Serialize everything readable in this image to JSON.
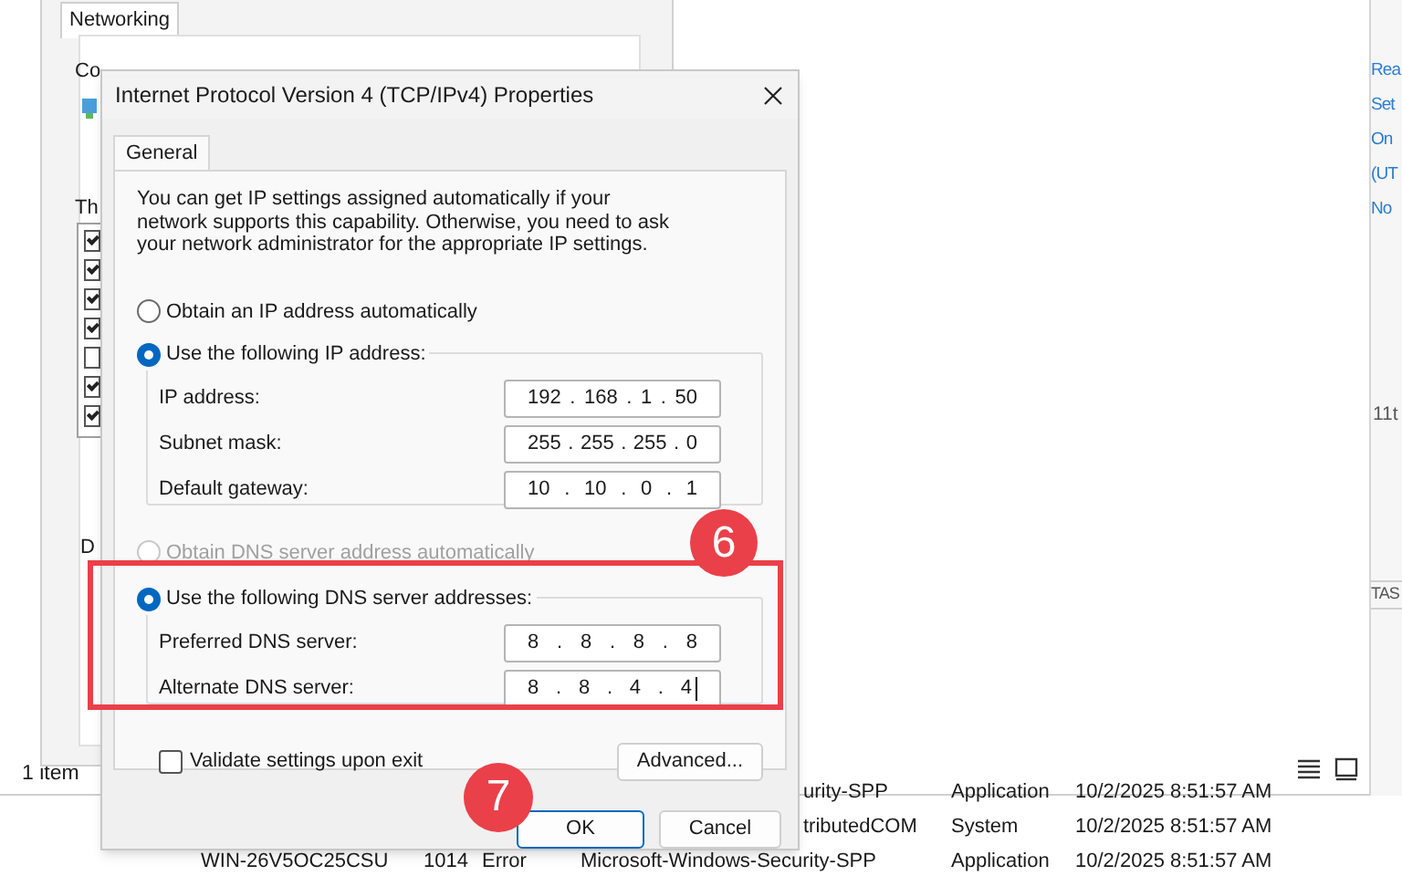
{
  "explorer": {
    "status": "1 item"
  },
  "networking_window": {
    "tab": "Networking",
    "label_1": "Co",
    "label_2": "Th",
    "label_3": "D",
    "items": [
      {
        "checked": true
      },
      {
        "checked": true
      },
      {
        "checked": true
      },
      {
        "checked": true
      },
      {
        "checked": false
      },
      {
        "checked": true
      },
      {
        "checked": true
      }
    ]
  },
  "side_panel": {
    "links": [
      "Rea",
      "Set",
      "On",
      "(UT",
      "No"
    ],
    "text_1": "11t",
    "text_2": "TAS"
  },
  "event_rows": [
    {
      "cells": [
        "urity-SPP",
        "Application",
        "10/2/2025 8:51:57 AM"
      ]
    },
    {
      "cells": [
        "tributedCOM",
        "System",
        "10/2/2025 8:51:57 AM"
      ]
    },
    {
      "cells": [
        "WIN-26V5OC25CSU",
        "1014",
        "Error",
        "Microsoft-Windows-Security-SPP",
        "Application",
        "10/2/2025 8:51:57 AM"
      ]
    }
  ],
  "dialog": {
    "title": "Internet Protocol Version 4 (TCP/IPv4) Properties",
    "tabs": [
      {
        "label": "General",
        "selected": true
      }
    ],
    "description": "You can get IP settings assigned automatically if your network supports this capability. Otherwise, you need to ask your network administrator for the appropriate IP settings.",
    "ip_auto": {
      "label": "Obtain an IP address automatically",
      "selected": false,
      "disabled": false
    },
    "ip_manual": {
      "label": "Use the following IP address:",
      "selected": true
    },
    "ip_fields": [
      {
        "label": "IP address:",
        "segments": [
          "192",
          ".",
          "168",
          ".",
          "1",
          ".",
          "50"
        ],
        "focused": false
      },
      {
        "label": "Subnet mask:",
        "segments": [
          "255",
          ".",
          "255",
          ".",
          "255",
          ".",
          "0"
        ],
        "focused": false
      },
      {
        "label": "Default gateway:",
        "segments": [
          "10",
          ".",
          "10",
          ".",
          "0",
          ".",
          "1"
        ],
        "focused": false
      }
    ],
    "dns_auto": {
      "label": "Obtain DNS server address automatically",
      "selected": false,
      "disabled": true
    },
    "dns_manual": {
      "label": "Use the following DNS server addresses:",
      "selected": true
    },
    "dns_fields": [
      {
        "label": "Preferred DNS server:",
        "segments": [
          "8",
          ".",
          "8",
          ".",
          "8",
          ".",
          "8"
        ],
        "focused": false
      },
      {
        "label": "Alternate DNS server:",
        "segments": [
          "8",
          ".",
          "8",
          ".",
          "4",
          ".",
          "4"
        ],
        "focused": true
      }
    ],
    "validate": {
      "label": "Validate settings upon exit",
      "checked": false
    },
    "advanced_button": "Advanced...",
    "ok_button": "OK",
    "cancel_button": "Cancel"
  },
  "step_badges": [
    {
      "label": "6"
    },
    {
      "label": "7"
    }
  ]
}
